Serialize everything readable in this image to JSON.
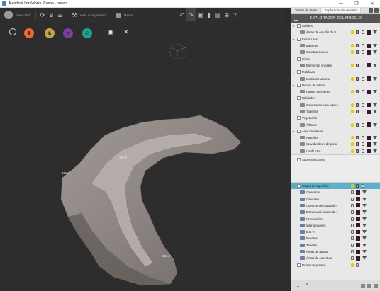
{
  "window": {
    "title": "Autodesk InfraWorks Prueba - nuevo",
    "controls": [
      "—",
      "❐",
      "✕"
    ]
  },
  "toolbar": {
    "user_name": "Elena Ruiz",
    "view_label": "Vista de ingeniería",
    "model_label": "Hacer"
  },
  "viewport": {
    "elevation_labels": [
      "360.0",
      "150.0",
      "350.0"
    ]
  },
  "panel": {
    "tabs": [
      "Temas de tarea",
      "Explorador del modelo"
    ],
    "active_tab": 1,
    "header_title": "EXPLORADOR DEL MODELO",
    "groups": [
      {
        "label": "Análisis",
        "children": [
          {
            "label": "Áreas de estudio de tr...",
            "color": "#3a1a2a"
          }
        ]
      },
      {
        "label": "Estructuras",
        "children": [
          {
            "label": "Barreras",
            "color": "#3a1a2a"
          },
          {
            "label": "Construcciones",
            "color": "#3a1a2a"
          }
        ]
      },
      {
        "label": "Línea",
        "children": [
          {
            "label": "Elementos lineales",
            "color": "#3a1a2a"
          }
        ]
      },
      {
        "label": "Mobiliario",
        "children": [
          {
            "label": "Mobiliario urbano",
            "color": "#3a1a2a"
          }
        ]
      },
      {
        "label": "Puntos de interés",
        "children": [
          {
            "label": "Puntos de interés",
            "color": "#3a1a2a"
          }
        ]
      },
      {
        "label": "Utilidades",
        "children": [
          {
            "label": "Conectores para tuber...",
            "color": "#3a1a2a"
          },
          {
            "label": "Tuberías",
            "color": "#3a1a2a"
          }
        ]
      },
      {
        "label": "Vegetación",
        "children": [
          {
            "label": "Árboles",
            "color": "#3a1a2a"
          }
        ]
      },
      {
        "label": "Área de interés",
        "children": [
          {
            "label": "Parcelas",
            "color": "#3a1a2a"
          },
          {
            "label": "Servidumbres de paso",
            "color": "#3a1a2a"
          },
          {
            "label": "Usufructos",
            "color": "#3a1a2a"
          }
        ]
      }
    ],
    "superposiciones_label": "Superposiciones",
    "surface_layers_label": "Capas de superficie",
    "surface_layers": [
      "Carreteras",
      "Caudales",
      "Cuencas de captación",
      "Estructuras finales de...",
      "Ferrocarriles",
      "Intersecciones",
      "D.D.T.",
      "Puentes",
      "Túneles",
      "Áreas de aguas",
      "Áreas de cobertura"
    ],
    "point_cloud_label": "Nubes de puntos"
  }
}
